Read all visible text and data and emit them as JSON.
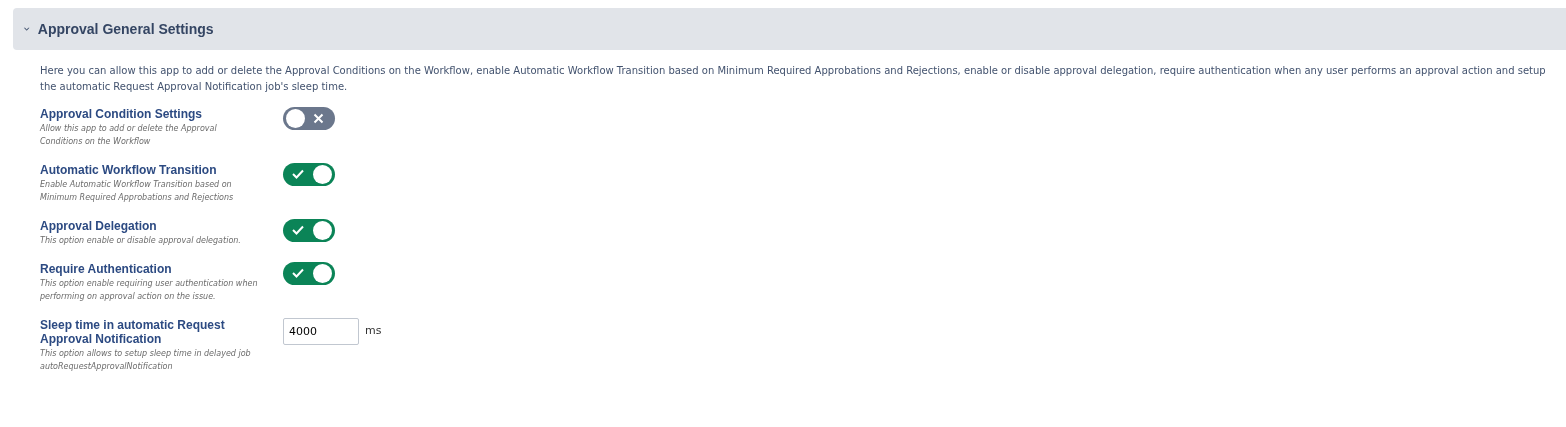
{
  "section": {
    "title": "Approval General Settings",
    "expanded": true,
    "chevron": "›",
    "description": "Here you can allow this app to add or delete the Approval Conditions on the Workflow, enable Automatic Workflow Transition based on Minimum Required Approbations and Rejections, enable or disable approval delegation, require authentication when any user performs an approval action and setup the automatic Request Approval Notification job's sleep time."
  },
  "settings": [
    {
      "kind": "toggle",
      "label": "Approval Condition Settings",
      "hint": "Allow this app to add or delete the Approval Conditions on the Workflow",
      "on": false
    },
    {
      "kind": "toggle",
      "label": "Automatic Workflow Transition",
      "hint": "Enable Automatic Workflow Transition based on Minimum Required Approbations and Rejections",
      "on": true
    },
    {
      "kind": "toggle",
      "label": "Approval Delegation",
      "hint": "This option enable or disable approval delegation.",
      "on": true
    },
    {
      "kind": "toggle",
      "label": "Require Authentication",
      "hint": "This option enable requiring user authentication when performing on approval action on the issue.",
      "on": true
    },
    {
      "kind": "number",
      "label": "Sleep time in automatic Request Approval Notification",
      "hint": "This option allows to setup sleep time in delayed job autoRequestApprovalNotification",
      "value": "4000",
      "unit": "ms"
    }
  ]
}
